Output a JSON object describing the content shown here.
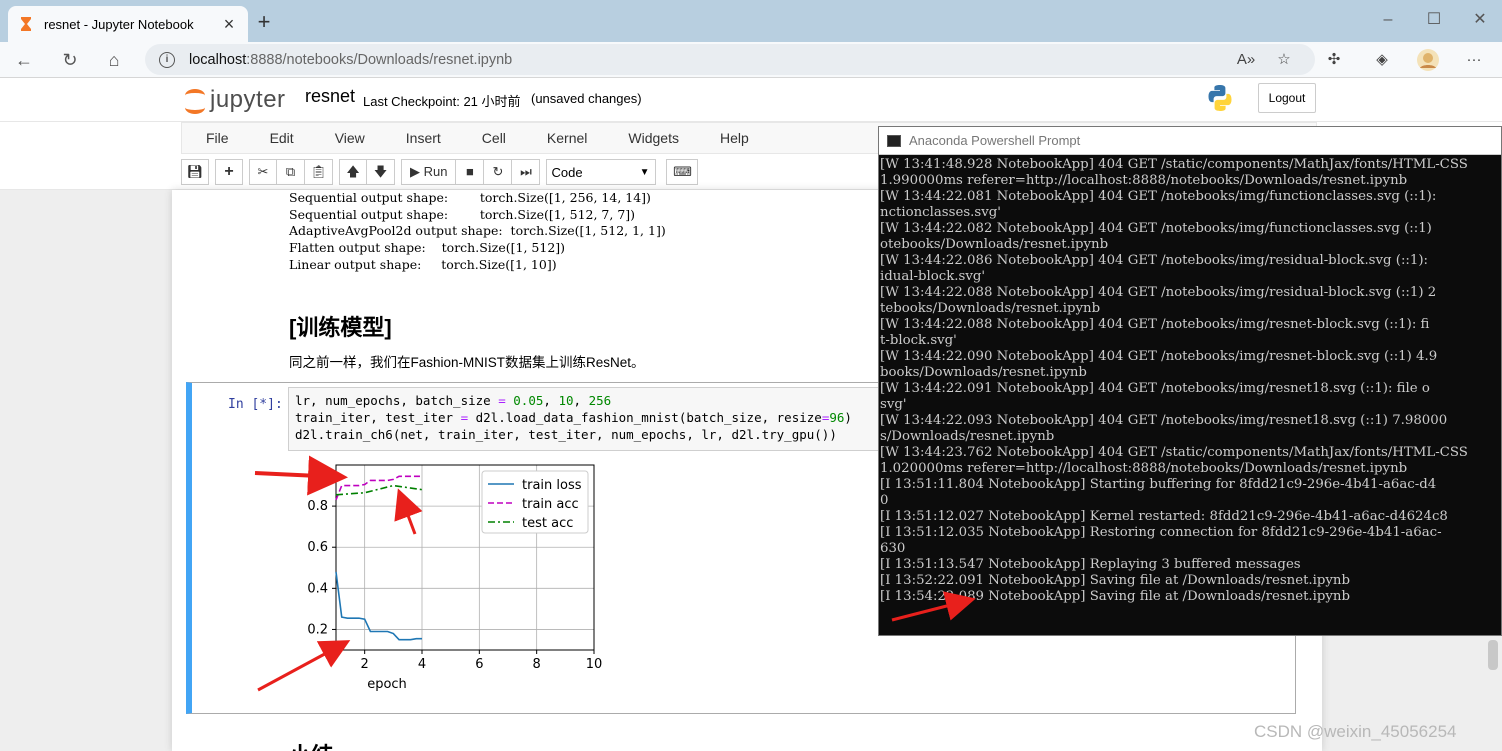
{
  "browser": {
    "tab_title": "resnet - Jupyter Notebook",
    "url_host": "localhost",
    "url_rest": ":8888/notebooks/Downloads/resnet.ipynb"
  },
  "jupyter": {
    "logo_text": "jupyter",
    "notebook_name": "resnet",
    "checkpoint": "Last Checkpoint: 21 小时前",
    "unsaved": "(unsaved changes)",
    "logout": "Logout",
    "menu": [
      "File",
      "Edit",
      "View",
      "Insert",
      "Cell",
      "Kernel",
      "Widgets",
      "Help"
    ],
    "run_label": "Run",
    "cell_type": "Code"
  },
  "notebook": {
    "output_lines": [
      "Sequential output shape:        torch.Size([1, 256, 14, 14])",
      "Sequential output shape:        torch.Size([1, 512, 7, 7])",
      "AdaptiveAvgPool2d output shape:  torch.Size([1, 512, 1, 1])",
      "Flatten output shape:    torch.Size([1, 512])",
      "Linear output shape:     torch.Size([1, 10])"
    ],
    "heading": "[训练模型]",
    "paragraph": "同之前一样，我们在Fashion-MNIST数据集上训练ResNet。",
    "prompt": "In  [*]:",
    "code_line1_a": "lr, num_epochs, batch_size ",
    "code_line1_eq": "=",
    "code_line1_v1": "0.05",
    "code_line1_v2": "10",
    "code_line1_v3": "256",
    "code_line2_a": "train_iter, test_iter ",
    "code_line2_eq": "=",
    "code_line2_b": " d2l.load_data_fashion_mnist(batch_size, resize",
    "code_line2_eq2": "=",
    "code_line2_v": "96",
    "code_line2_c": ")",
    "code_line3": "d2l.train_ch6(net, train_iter, test_iter, num_epochs, lr, d2l.try_gpu())",
    "bottom_heading": "小结"
  },
  "chart_data": {
    "type": "line",
    "xlabel": "epoch",
    "ylabel": "",
    "xlim": [
      1,
      10
    ],
    "ylim": [
      0.1,
      1.0
    ],
    "xticks": [
      "2",
      "4",
      "6",
      "8",
      "10"
    ],
    "yticks": [
      "0.2",
      "0.4",
      "0.6",
      "0.8"
    ],
    "grid": true,
    "legend_position": "top-right",
    "series": [
      {
        "name": "train loss",
        "color": "#1f77b4",
        "style": "solid",
        "x": [
          1.0,
          1.2,
          1.4,
          1.6,
          1.8,
          2.0,
          2.2,
          2.4,
          2.6,
          2.8,
          3.0,
          3.2,
          3.4,
          3.6,
          3.8,
          4.0
        ],
        "y": [
          0.48,
          0.26,
          0.255,
          0.255,
          0.255,
          0.25,
          0.19,
          0.19,
          0.19,
          0.19,
          0.18,
          0.15,
          0.15,
          0.15,
          0.155,
          0.155
        ]
      },
      {
        "name": "train acc",
        "color": "#bf00bf",
        "style": "dashed",
        "x": [
          1.0,
          1.2,
          1.4,
          1.6,
          1.8,
          2.0,
          2.2,
          2.4,
          2.6,
          2.8,
          3.0,
          3.2,
          3.4,
          3.6,
          3.8,
          4.0
        ],
        "y": [
          0.83,
          0.9,
          0.9,
          0.9,
          0.9,
          0.905,
          0.925,
          0.925,
          0.925,
          0.925,
          0.93,
          0.945,
          0.945,
          0.945,
          0.945,
          0.945
        ]
      },
      {
        "name": "test acc",
        "color": "#008000",
        "style": "dashdot",
        "x": [
          1.0,
          2.0,
          3.0,
          4.0
        ],
        "y": [
          0.855,
          0.865,
          0.9,
          0.88
        ]
      }
    ]
  },
  "terminal": {
    "title": "Anaconda Powershell Prompt",
    "lines": [
      "[W 13:41:48.928 NotebookApp] 404 GET /static/components/MathJax/fonts/HTML-CSS",
      "1.990000ms referer=http://localhost:8888/notebooks/Downloads/resnet.ipynb",
      "[W 13:44:22.081 NotebookApp] 404 GET /notebooks/img/functionclasses.svg (::1):",
      "nctionclasses.svg'",
      "[W 13:44:22.082 NotebookApp] 404 GET /notebooks/img/functionclasses.svg (::1)",
      "otebooks/Downloads/resnet.ipynb",
      "[W 13:44:22.086 NotebookApp] 404 GET /notebooks/img/residual-block.svg (::1):",
      "idual-block.svg'",
      "[W 13:44:22.088 NotebookApp] 404 GET /notebooks/img/residual-block.svg (::1) 2",
      "tebooks/Downloads/resnet.ipynb",
      "[W 13:44:22.088 NotebookApp] 404 GET /notebooks/img/resnet-block.svg (::1): fi",
      "t-block.svg'",
      "[W 13:44:22.090 NotebookApp] 404 GET /notebooks/img/resnet-block.svg (::1) 4.9",
      "books/Downloads/resnet.ipynb",
      "[W 13:44:22.091 NotebookApp] 404 GET /notebooks/img/resnet18.svg (::1): file o",
      "svg'",
      "[W 13:44:22.093 NotebookApp] 404 GET /notebooks/img/resnet18.svg (::1) 7.98000",
      "s/Downloads/resnet.ipynb",
      "[W 13:44:23.762 NotebookApp] 404 GET /static/components/MathJax/fonts/HTML-CSS",
      "1.020000ms referer=http://localhost:8888/notebooks/Downloads/resnet.ipynb",
      "[I 13:51:11.804 NotebookApp] Starting buffering for 8fdd21c9-296e-4b41-a6ac-d4",
      "0",
      "[I 13:51:12.027 NotebookApp] Kernel restarted: 8fdd21c9-296e-4b41-a6ac-d4624c8",
      "[I 13:51:12.035 NotebookApp] Restoring connection for 8fdd21c9-296e-4b41-a6ac-",
      "630",
      "[I 13:51:13.547 NotebookApp] Replaying 3 buffered messages",
      "[I 13:52:22.091 NotebookApp] Saving file at /Downloads/resnet.ipynb",
      "[I 13:54:22.089 NotebookApp] Saving file at /Downloads/resnet.ipynb"
    ]
  },
  "watermark": "CSDN @weixin_45056254"
}
